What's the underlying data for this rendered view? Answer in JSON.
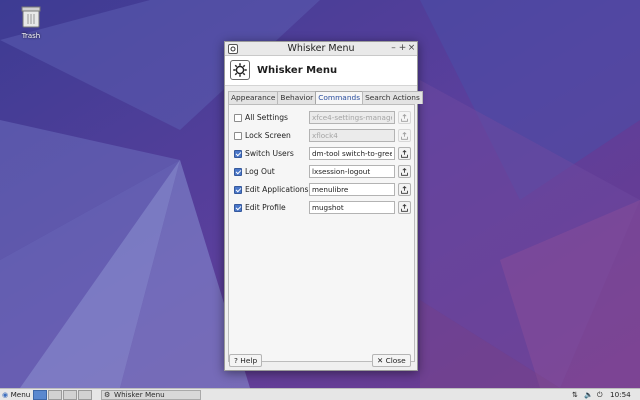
{
  "desktop": {
    "trash_label": "Trash"
  },
  "window": {
    "title": "Whisker Menu",
    "header_title": "Whisker Menu",
    "controls": {
      "minimize": "–",
      "maximize": "+",
      "close": "×"
    }
  },
  "tabs": [
    {
      "label": "Appearance",
      "active": false
    },
    {
      "label": "Behavior",
      "active": false
    },
    {
      "label": "Commands",
      "active": true
    },
    {
      "label": "Search Actions",
      "active": false
    }
  ],
  "commands": [
    {
      "label": "All Settings",
      "checked": false,
      "value": "xfce4-settings-manager",
      "enabled": false
    },
    {
      "label": "Lock Screen",
      "checked": false,
      "value": "xflock4",
      "enabled": false
    },
    {
      "label": "Switch Users",
      "checked": true,
      "value": "dm-tool switch-to-greeter",
      "enabled": true
    },
    {
      "label": "Log Out",
      "checked": true,
      "value": "lxsession-logout",
      "enabled": true
    },
    {
      "label": "Edit Applications",
      "checked": true,
      "value": "menulibre",
      "enabled": true
    },
    {
      "label": "Edit Profile",
      "checked": true,
      "value": "mugshot",
      "enabled": true
    }
  ],
  "footer": {
    "help_label": "Help",
    "close_label": "Close"
  },
  "taskbar": {
    "menu_label": "Menu",
    "task_label": "Whisker Menu",
    "clock": "10:54"
  },
  "colors": {
    "accent": "#4a77c9",
    "wallpaper_base": "#4a3f9a"
  }
}
